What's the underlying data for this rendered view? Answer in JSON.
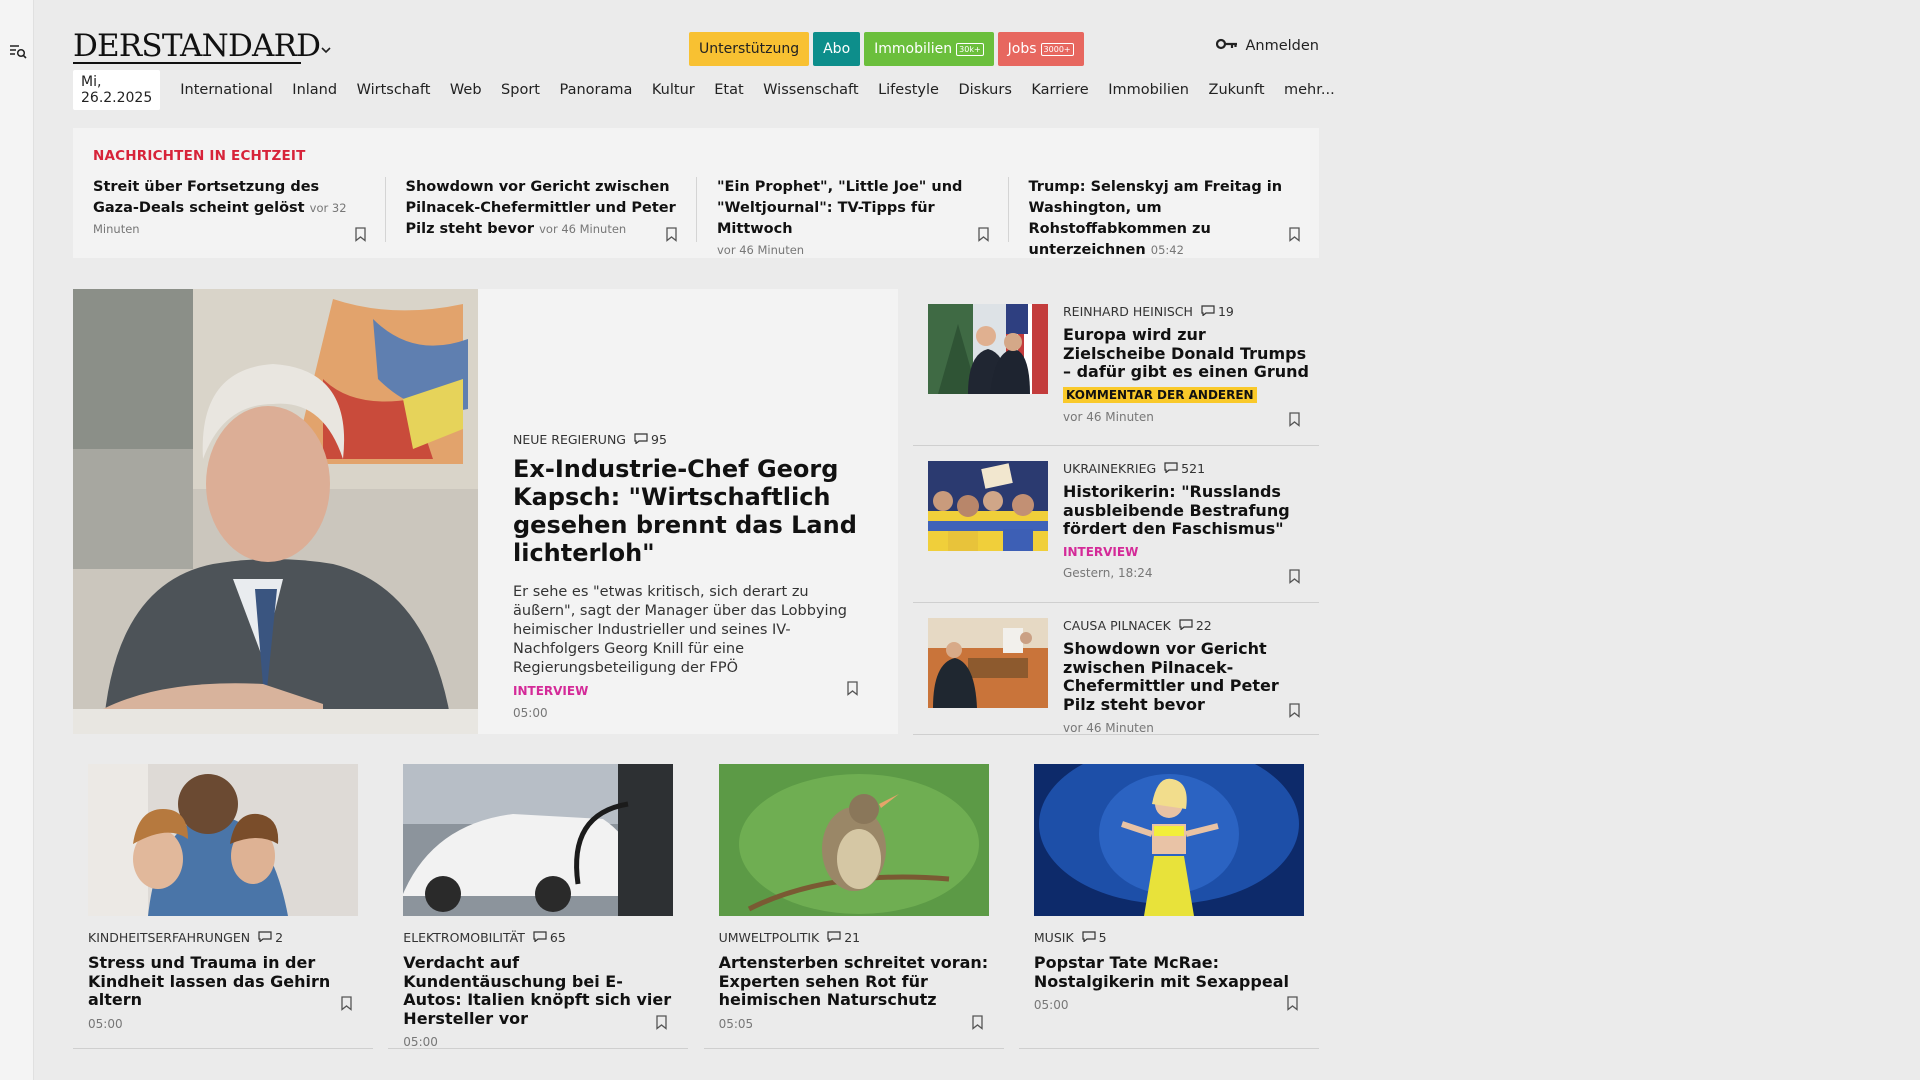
{
  "header": {
    "logo": "DERSTANDARD",
    "pills": [
      {
        "label": "Unterstützung",
        "badge": ""
      },
      {
        "label": "Abo",
        "badge": ""
      },
      {
        "label": "Immobilien",
        "badge": "30k+"
      },
      {
        "label": "Jobs",
        "badge": "3000+"
      }
    ],
    "login_label": "Anmelden"
  },
  "nav": {
    "date": "Mi, 26.2.2025",
    "items": [
      "International",
      "Inland",
      "Wirtschaft",
      "Web",
      "Sport",
      "Panorama",
      "Kultur",
      "Etat",
      "Wissenschaft",
      "Lifestyle",
      "Diskurs",
      "Karriere",
      "Immobilien",
      "Zukunft",
      "mehr..."
    ]
  },
  "ticker": {
    "label": "NACHRICHTEN IN ECHTZEIT",
    "items": [
      {
        "title": "Streit über Fortsetzung des Gaza-Deals scheint gelöst",
        "time": "vor 32 Minuten"
      },
      {
        "title": "Showdown vor Gericht zwischen Pilnacek-Chefermittler und Peter Pilz steht bevor",
        "time": "vor 46 Minuten"
      },
      {
        "title": "\"Ein Prophet\", \"Little Joe\" und \"Weltjournal\": TV-Tipps für Mittwoch",
        "time": "vor 46 Minuten"
      },
      {
        "title": "Trump: Selenskyj am Freitag in Washington, um Rohstoffabkommen zu unterzeichnen",
        "time": "05:42"
      }
    ]
  },
  "hero": {
    "kicker": "NEUE REGIERUNG",
    "comments": "95",
    "title": "Ex-Industrie-Chef Georg Kapsch: \"Wirtschaftlich gesehen brennt das Land lichterloh\"",
    "lead": "Er sehe es \"etwas kritisch, sich derart zu äußern\", sagt der Manager über das Lobbying heimischer Industrieller und seines IV-Nachfolgers Georg Knill für eine Regierungsbeteiligung der FPÖ",
    "tag": "INTERVIEW",
    "time": "05:00"
  },
  "side": [
    {
      "kicker": "REINHARD HEINISCH",
      "comments": "19",
      "title": "Europa wird zur Zielscheibe Donald Trumps – dafür gibt es einen Grund",
      "tag": "KOMMENTAR DER ANDEREN",
      "time": "vor 46 Minuten"
    },
    {
      "kicker": "UKRAINEKRIEG",
      "comments": "521",
      "title": "Historikerin: \"Russlands ausbleibende Bestrafung fördert den Faschismus\"",
      "tag": "INTERVIEW",
      "time": "Gestern, 18:24"
    },
    {
      "kicker": "CAUSA PILNACEK",
      "comments": "22",
      "title": "Showdown vor Gericht zwischen Pilnacek-Chefermittler und Peter Pilz steht bevor",
      "tag": "",
      "time": "vor 46 Minuten"
    }
  ],
  "cards": [
    {
      "kicker": "KINDHEITSERFAHRUNGEN",
      "comments": "2",
      "title": "Stress und Trauma in der Kindheit lassen das Gehirn altern",
      "time": "05:00"
    },
    {
      "kicker": "ELEKTROMOBILITÄT",
      "comments": "65",
      "title": "Verdacht auf Kundentäuschung bei E-Autos: Italien knöpft sich vier Hersteller vor",
      "time": "05:00"
    },
    {
      "kicker": "UMWELTPOLITIK",
      "comments": "21",
      "title": "Artensterben schreitet voran: Experten sehen Rot für heimischen Naturschutz",
      "time": "05:05"
    },
    {
      "kicker": "MUSIK",
      "comments": "5",
      "title": "Popstar Tate McRae: Nostalgikerin mit Sexappeal",
      "time": "05:00"
    }
  ]
}
